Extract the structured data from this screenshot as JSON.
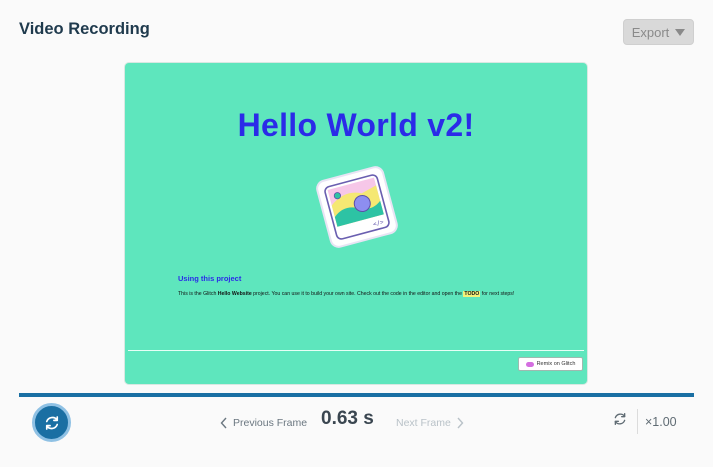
{
  "header": {
    "title": "Video Recording",
    "export_label": "Export"
  },
  "preview": {
    "heading": "Hello World v2!",
    "section_title": "Using this project",
    "body_prefix": "This is the Glitch ",
    "body_bold": "Hello Website",
    "body_middle": " project. You can use it to build your own site. Check out the code in the editor and open the ",
    "body_todo": "TODO",
    "body_suffix": " for next steps!",
    "remix_label": "Remix on Glitch",
    "illustration_code": "</>"
  },
  "playback": {
    "progress": 1.0,
    "prev_label": "Previous Frame",
    "time_display": "0.63 s",
    "next_label": "Next Frame",
    "speed_label": "×1.00"
  },
  "icons": {
    "export": "caret-down-icon",
    "replay": "refresh-icon",
    "loop": "loop-icon",
    "prev": "chevron-left-icon",
    "next": "chevron-right-icon"
  },
  "colors": {
    "accent": "#1a6fa3",
    "preview_bg": "#5ee6bd",
    "heading": "#2b2be8"
  }
}
